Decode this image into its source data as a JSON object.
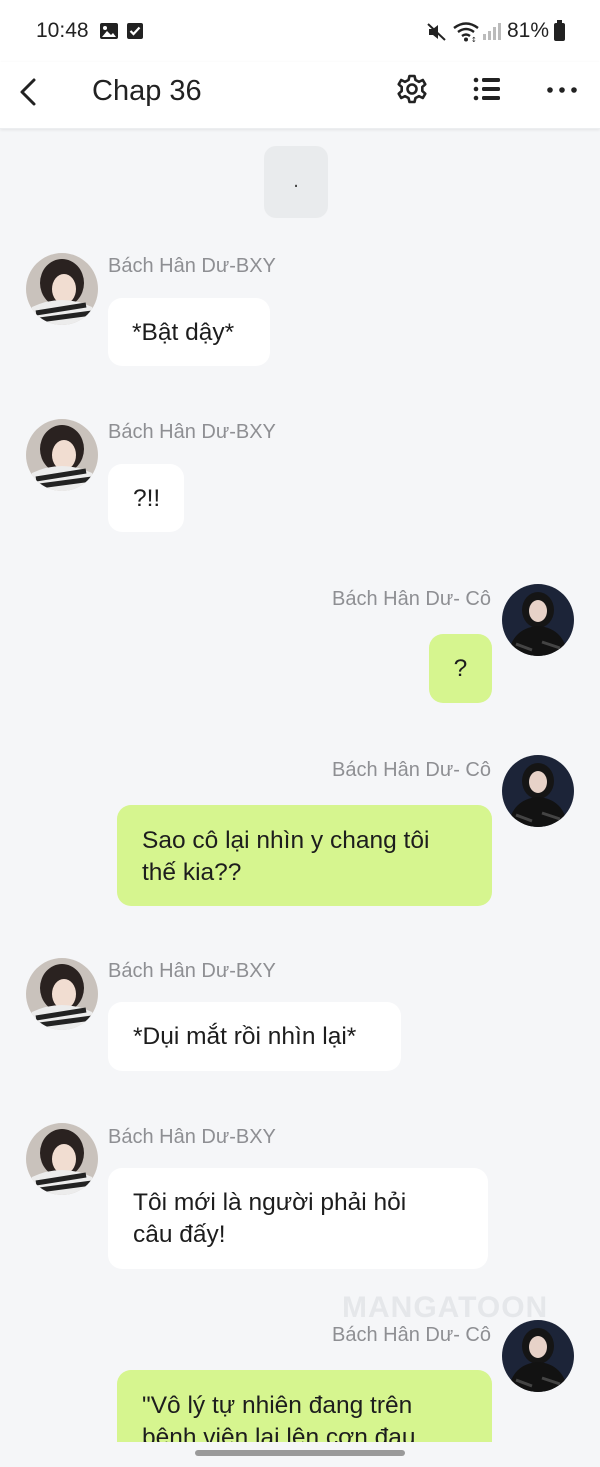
{
  "status_bar": {
    "time": "10:48",
    "battery": "81%",
    "icons": [
      "gallery-icon",
      "check-box-icon",
      "mute-icon",
      "wifi-icon",
      "signal-icon",
      "battery-icon"
    ]
  },
  "app_bar": {
    "title": "Chap 36",
    "icons": [
      "back-icon",
      "settings-icon",
      "list-icon",
      "more-icon"
    ]
  },
  "chat": {
    "system_message": ".",
    "messages": [
      {
        "side": "left",
        "name": "Bách Hân Dư-BXY",
        "text": "*Bật dậy*"
      },
      {
        "side": "left",
        "name": "Bách Hân Dư-BXY",
        "text": "?!!"
      },
      {
        "side": "right",
        "name": "Bách Hân Dư- Cô",
        "text": "?"
      },
      {
        "side": "right",
        "name": "Bách Hân Dư- Cô",
        "text_lines": [
          "Sao cô lại nhìn y chang tôi",
          "thế kia??"
        ]
      },
      {
        "side": "left",
        "name": "Bách Hân Dư-BXY",
        "text": "*Dụi mắt rồi nhìn lại*"
      },
      {
        "side": "left",
        "name": "Bách Hân Dư-BXY",
        "text_lines": [
          "Tôi mới là người phải hỏi",
          "câu đấy!"
        ]
      },
      {
        "side": "right",
        "name": "Bách Hân Dư- Cô",
        "text_lines": [
          "\"Vô lý tự nhiên đang trên",
          "bệnh viện lại lên cơn đau"
        ]
      }
    ],
    "watermark": "MANGATOON"
  },
  "colors": {
    "background": "#f5f6f8",
    "bubble_left": "#ffffff",
    "bubble_right": "#d6f58f",
    "name_text": "#8e8f93"
  }
}
